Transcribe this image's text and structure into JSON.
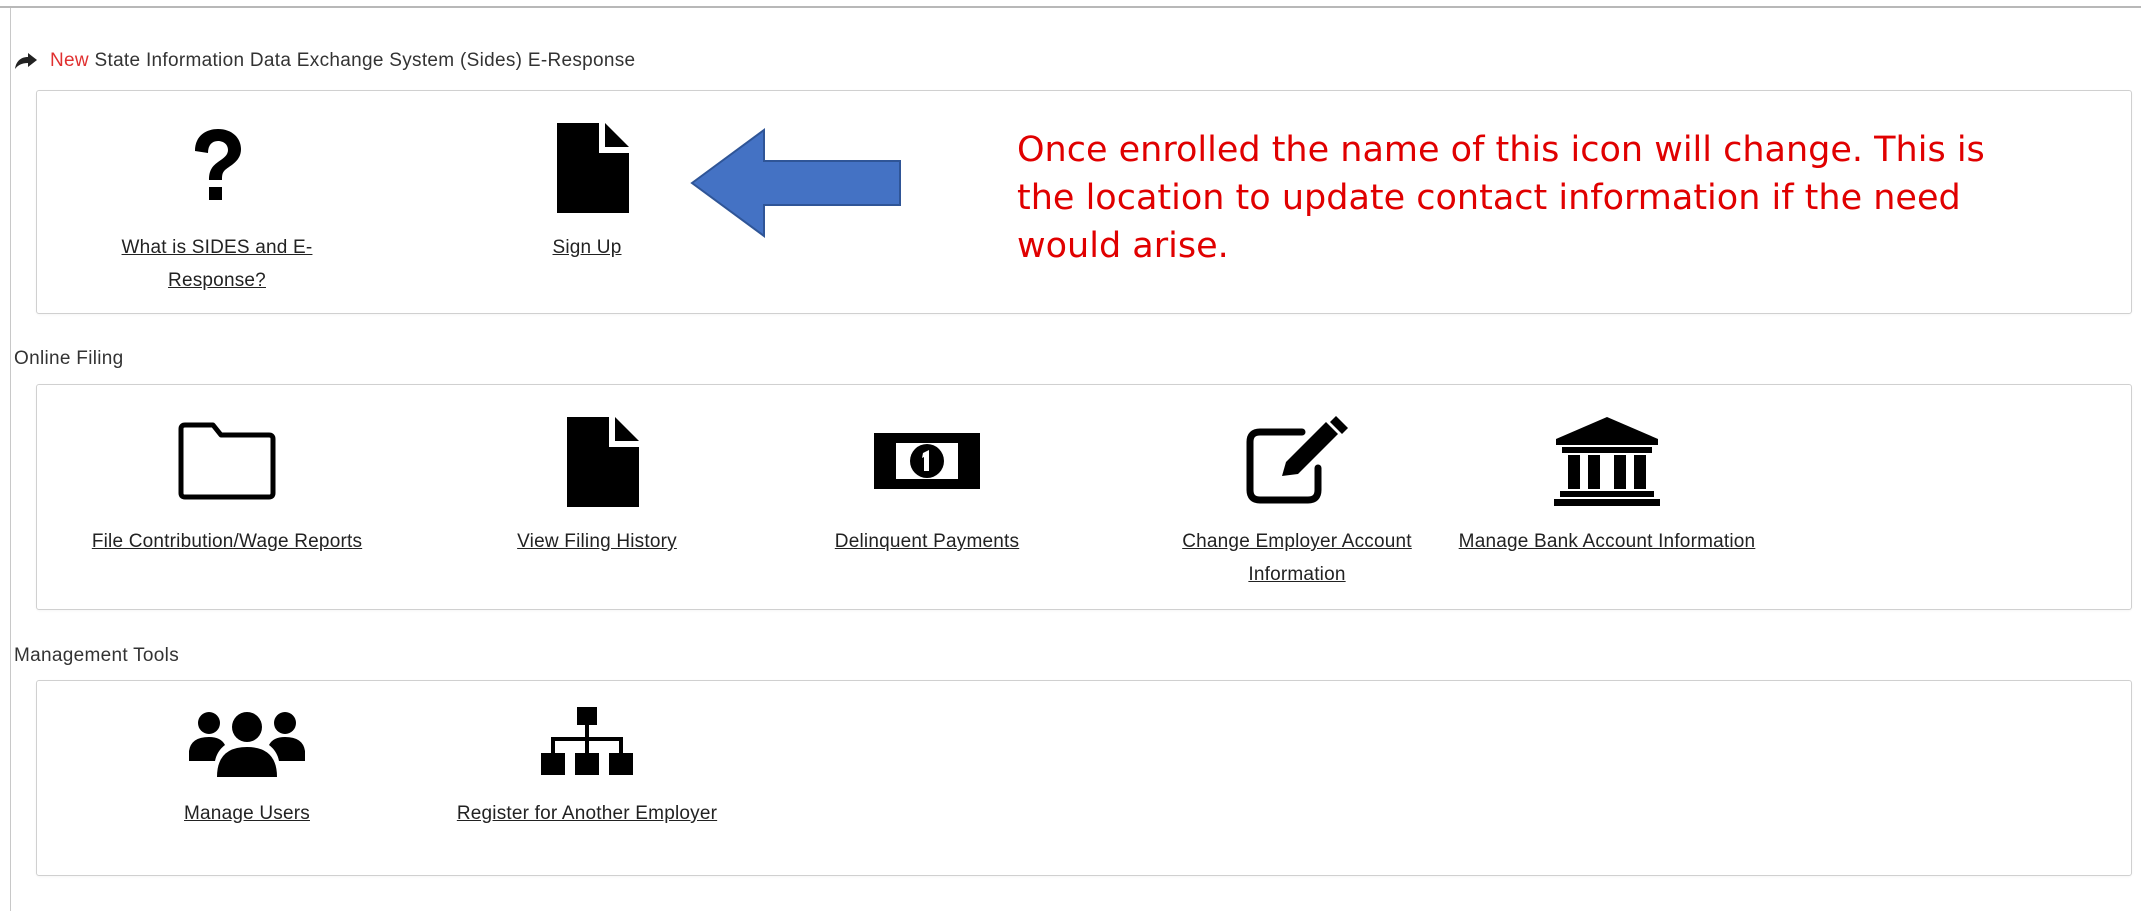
{
  "sides_section": {
    "new_label": "New",
    "title": "State Information Data Exchange System (Sides) E-Response",
    "tiles": [
      {
        "label": "What is SIDES and E-Response?",
        "icon": "question-icon"
      },
      {
        "label": "Sign Up",
        "icon": "document-icon"
      }
    ]
  },
  "annotation": {
    "text": "Once enrolled the name of this icon will change. This is the location to update contact information if the need would arise.",
    "arrow_color": "#4472c4"
  },
  "online_filing": {
    "title": "Online Filing",
    "tiles": [
      {
        "label": "File Contribution/Wage Reports",
        "icon": "folder-icon"
      },
      {
        "label": "View Filing History",
        "icon": "document-icon"
      },
      {
        "label": "Delinquent Payments",
        "icon": "money-icon"
      },
      {
        "label": "Change Employer Account Information",
        "icon": "edit-icon"
      },
      {
        "label": "Manage Bank Account Information",
        "icon": "bank-icon"
      }
    ]
  },
  "management_tools": {
    "title": "Management Tools",
    "tiles": [
      {
        "label": "Manage Users",
        "icon": "users-icon"
      },
      {
        "label": "Register for Another Employer",
        "icon": "sitemap-icon"
      }
    ]
  },
  "colors": {
    "accent_red": "#e03030",
    "annotation_red": "#e00000",
    "link_text": "#222222"
  }
}
